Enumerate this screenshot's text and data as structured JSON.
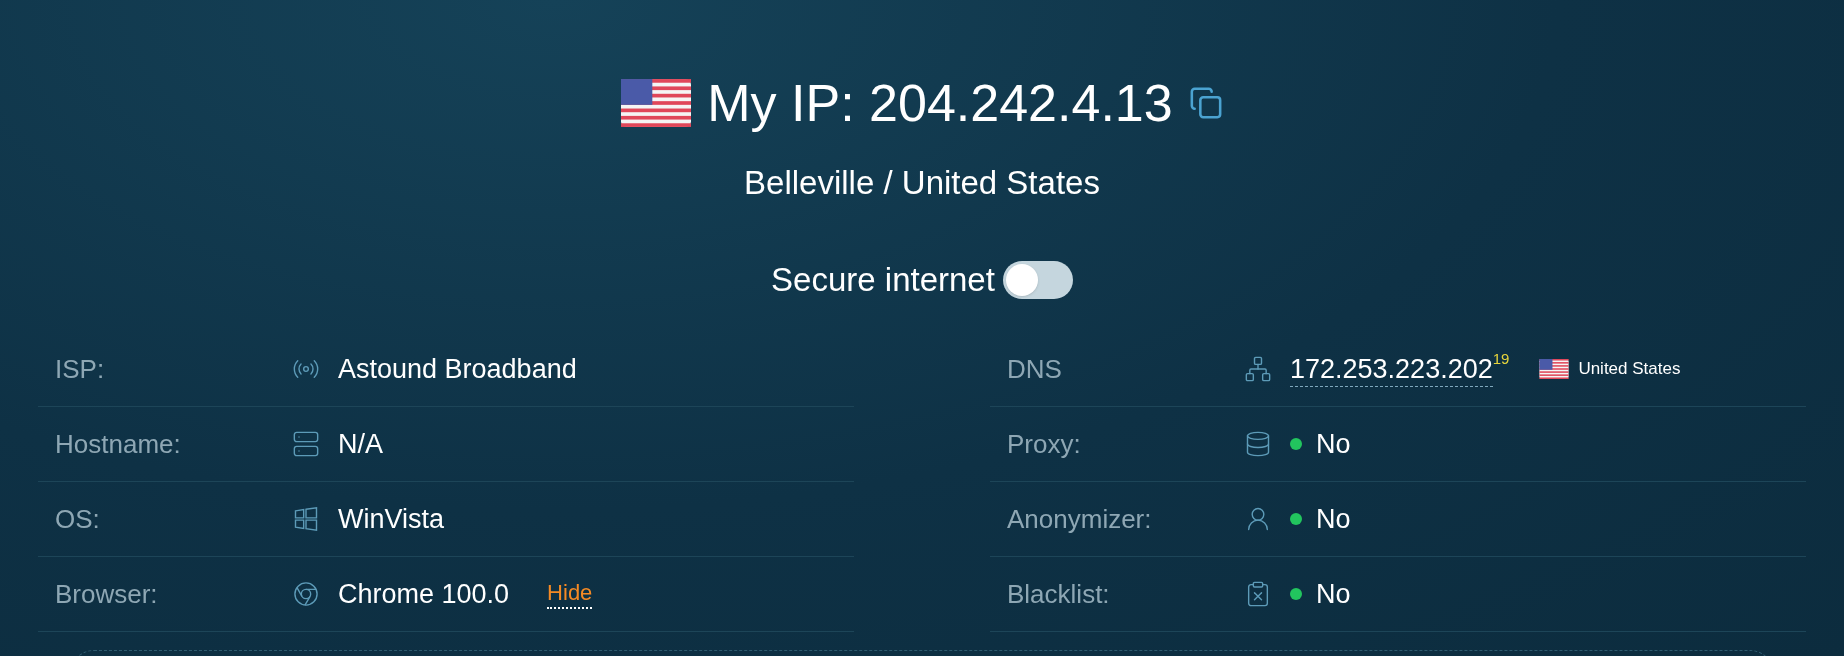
{
  "header": {
    "title": "My IP: 204.242.4.13",
    "location": "Belleville / United States"
  },
  "secure_internet": {
    "label": "Secure internet",
    "on": false
  },
  "left_rows": [
    {
      "kind": "isp",
      "label": "ISP:",
      "value": "Astound Broadband"
    },
    {
      "kind": "hostname",
      "label": "Hostname:",
      "value": "N/A"
    },
    {
      "kind": "os",
      "label": "OS:",
      "value": "WinVista"
    },
    {
      "kind": "browser",
      "label": "Browser:",
      "value": "Chrome 100.0",
      "action": "Hide"
    }
  ],
  "right_rows": [
    {
      "kind": "dns",
      "label": "DNS",
      "value": "172.253.223.202",
      "count": "19",
      "country": "United States"
    },
    {
      "kind": "proxy",
      "label": "Proxy:",
      "value": "No",
      "color": "#22c55e"
    },
    {
      "kind": "anonymizer",
      "label": "Anonymizer:",
      "value": "No",
      "color": "#22c55e"
    },
    {
      "kind": "blacklist",
      "label": "Blacklist:",
      "value": "No",
      "color": "#22c55e"
    }
  ]
}
